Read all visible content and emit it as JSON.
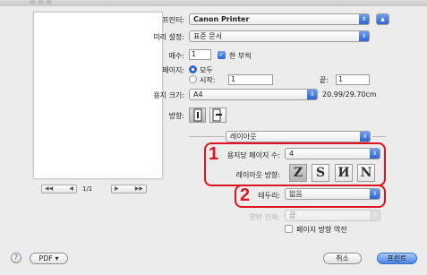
{
  "printer": {
    "label": "프린터:",
    "value": "Canon Printer"
  },
  "presets": {
    "label": "미리 설정:",
    "value": "표준 문서"
  },
  "copies": {
    "label": "매수:",
    "value": "1",
    "collate_label": "한 부씩"
  },
  "pages": {
    "label": "페이지:",
    "all_label": "모두",
    "from_label": "시작:",
    "from_value": "1",
    "to_label": "끝:",
    "to_value": "1"
  },
  "paper": {
    "label": "용지 크기:",
    "value": "A4",
    "dimensions": "20.99/29.70cm"
  },
  "orientation": {
    "label": "방향:"
  },
  "panel": {
    "value": "레이아웃"
  },
  "layout": {
    "pages_per_sheet_label": "용지당 페이지 수:",
    "pages_per_sheet_value": "4",
    "direction_label": "레이아웃 방향:",
    "direction_glyphs": [
      "Z",
      "S",
      "И",
      "N"
    ]
  },
  "border": {
    "label": "테두리:",
    "value": "없음"
  },
  "twosided": {
    "label": "양면 인쇄:",
    "value": "끔"
  },
  "reverse": {
    "label": "페이지 방향 역전"
  },
  "callouts": {
    "one": "1",
    "two": "2"
  },
  "nav": {
    "first": "◀◀",
    "prev": "◀",
    "next": "▶",
    "last": "▶▶",
    "page_indicator": "1/1"
  },
  "footer": {
    "help": "?",
    "pdf_label": "PDF ▾",
    "cancel_label": "취소",
    "print_label": "프린트"
  }
}
